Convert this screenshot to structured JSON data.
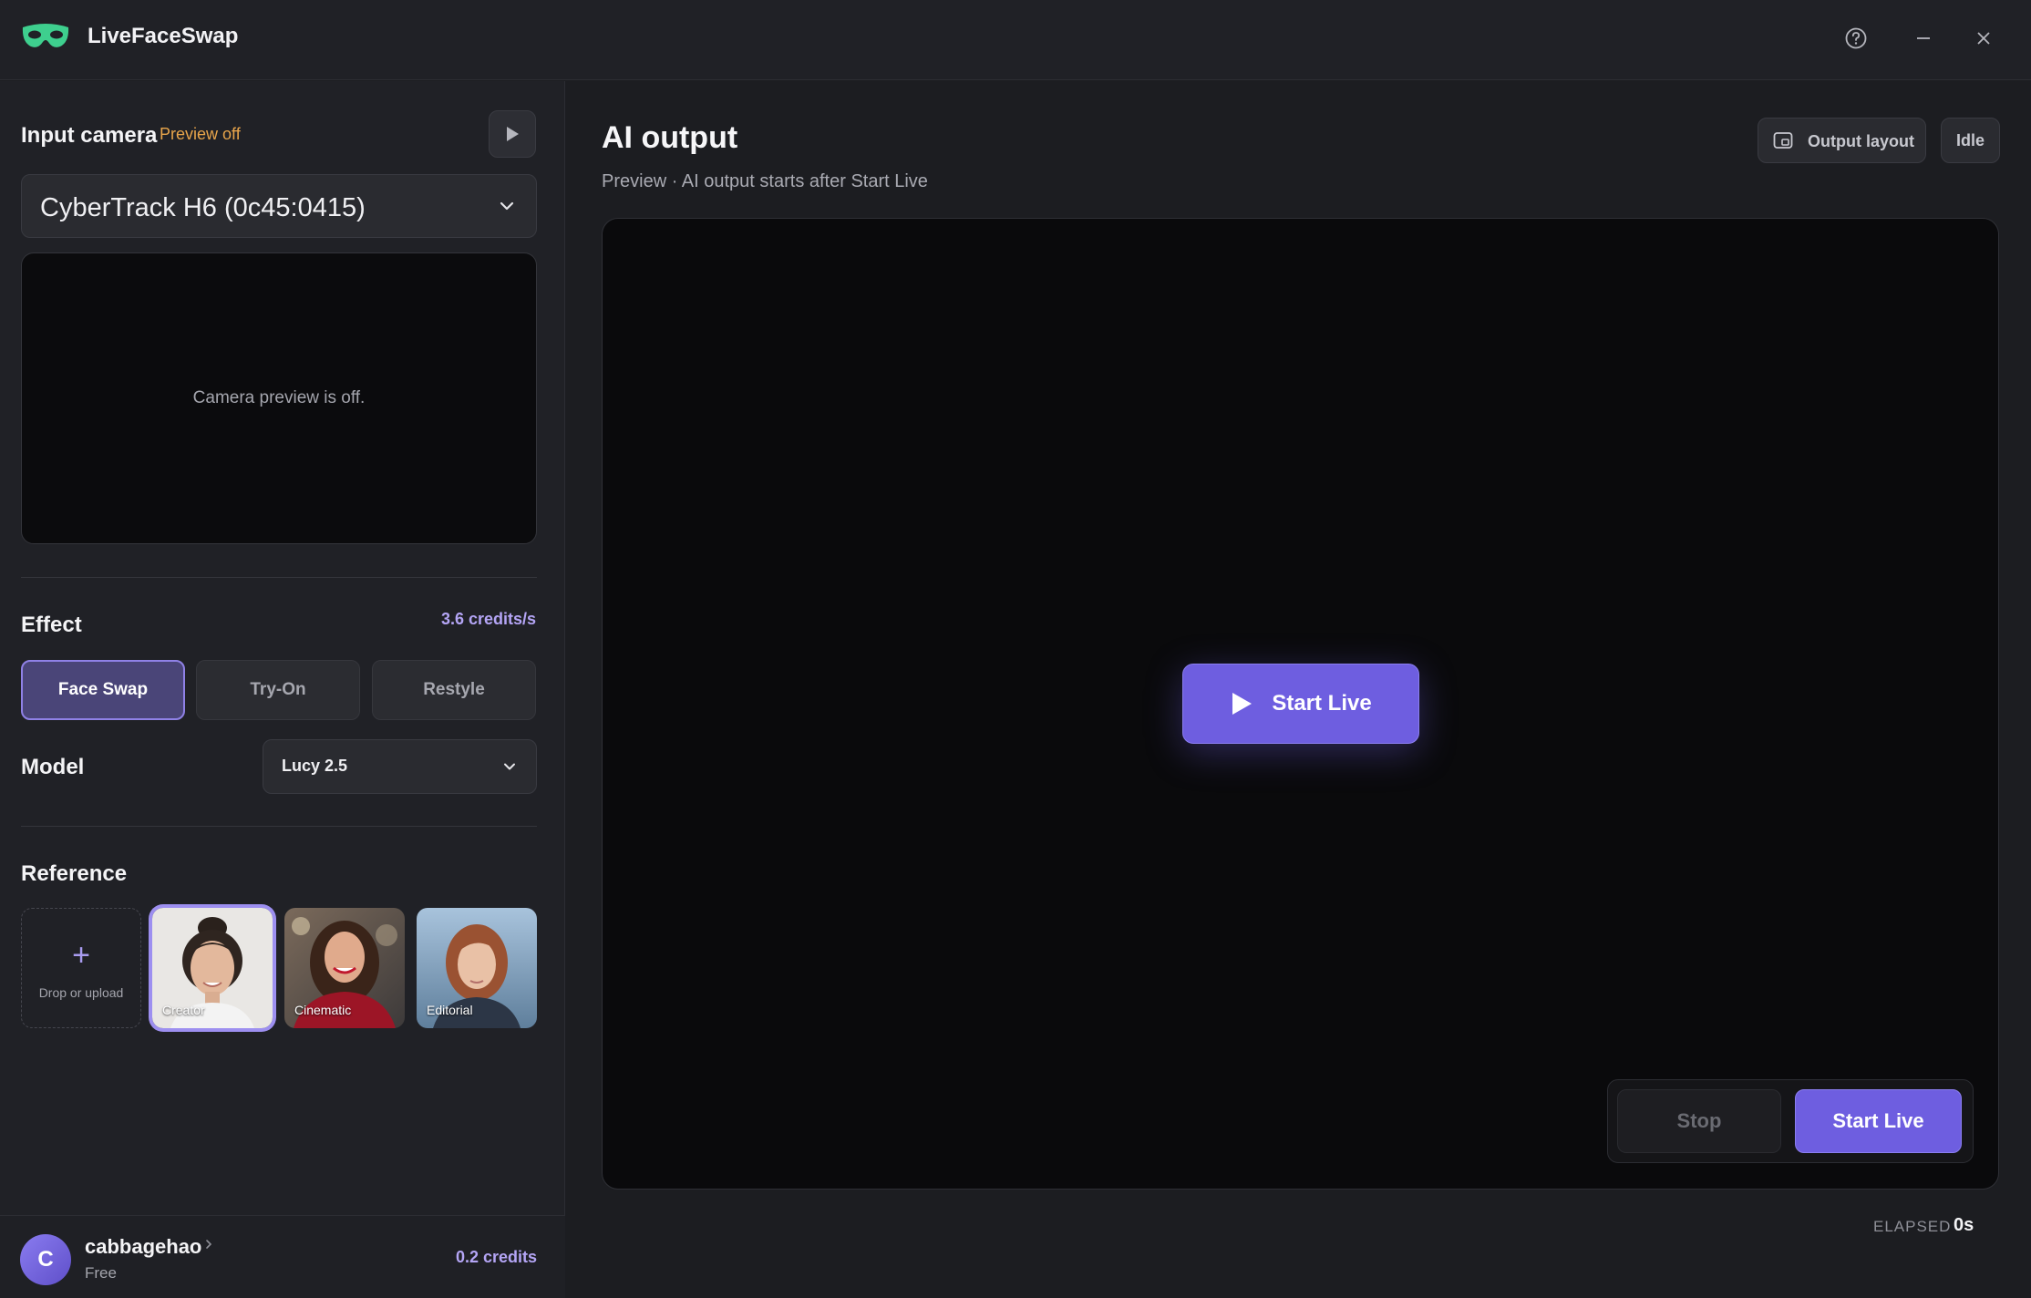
{
  "app": {
    "title": "LiveFaceSwap",
    "icons": {
      "logo": "mask-icon",
      "help": "help-circle-icon",
      "minimize": "minimize-icon",
      "close": "close-icon"
    },
    "accent": "#6e5ee0",
    "logo_color": "#3ecf8e"
  },
  "sidebar": {
    "input_camera": {
      "title": "Input camera",
      "preview_status": "Preview off",
      "device": "CyberTrack H6 (0c45:0415)",
      "preview_message": "Camera preview is off."
    },
    "effect": {
      "title": "Effect",
      "rate": "3.6 credits/s",
      "options": [
        {
          "label": "Face Swap",
          "active": true
        },
        {
          "label": "Try-On",
          "active": false
        },
        {
          "label": "Restyle",
          "active": false
        }
      ]
    },
    "model": {
      "title": "Model",
      "selected": "Lucy 2.5"
    },
    "reference": {
      "title": "Reference",
      "upload_label": "Drop or upload",
      "items": [
        {
          "label": "Creator",
          "selected": true
        },
        {
          "label": "Cinematic",
          "selected": false
        },
        {
          "label": "Editorial",
          "selected": false
        }
      ]
    },
    "user": {
      "initial": "C",
      "name": "cabbagehao",
      "plan": "Free",
      "credits": "0.2 credits"
    }
  },
  "main": {
    "title": "AI output",
    "subtitle": "Preview · AI output starts after Start Live",
    "output_layout_label": "Output layout",
    "status": "Idle",
    "start_center_label": "Start Live",
    "stop_label": "Stop",
    "start_label": "Start Live",
    "elapsed_label": "ELAPSED",
    "elapsed_value": "0s"
  }
}
